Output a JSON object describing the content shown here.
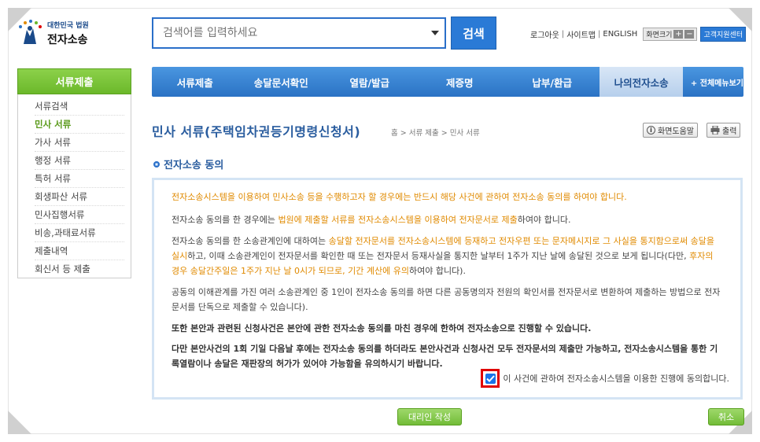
{
  "header": {
    "logo_small": "대한민국 법원",
    "logo_big": "전자소송",
    "search_placeholder": "검색어를 입력하세요",
    "search_button": "검색",
    "util_links": [
      "로그아웃",
      "사이트맵",
      "ENGLISH"
    ],
    "font_size_label": "화면크기",
    "font_plus": "+",
    "font_minus": "−",
    "customer_center": "고객지원센터"
  },
  "sidebar": {
    "title": "서류제출",
    "items": [
      {
        "label": "서류검색"
      },
      {
        "label": "민사 서류",
        "active": true
      },
      {
        "label": "가사 서류"
      },
      {
        "label": "행정 서류"
      },
      {
        "label": "특허 서류"
      },
      {
        "label": "회생파산 서류"
      },
      {
        "label": "민사집행서류"
      },
      {
        "label": "비송,과태료서류"
      },
      {
        "label": "제출내역"
      },
      {
        "label": "회신서 등 제출"
      }
    ]
  },
  "nav": {
    "items": [
      {
        "label": "서류제출"
      },
      {
        "label": "송달문서확인"
      },
      {
        "label": "열람/발급"
      },
      {
        "label": "제증명"
      },
      {
        "label": "납부/환급"
      },
      {
        "label": "나의전자소송",
        "active": true
      }
    ],
    "all_menu": "+ 전체메뉴보기"
  },
  "page": {
    "title": "민사 서류(주택임차권등기명령신청서)",
    "breadcrumb": "홈 > 서류 제출 > 민사 서류",
    "help_button": "화면도움말",
    "print_button": "출력"
  },
  "section": {
    "title": "전자소송 동의"
  },
  "content": {
    "p1": "전자소송시스템을 이용하여 민사소송 등을 수행하고자 할 경우에는 반드시 해당 사건에 관하여 전자소송 동의를 하여야 합니다.",
    "p2_a": "전자소송 동의를 한 경우에는 ",
    "p2_hl": "법원에 제출할 서류를 전자소송시스템을 이용하여 전자문서로 제출",
    "p2_b": "하여야 합니다.",
    "p3_a": "전자소송 동의를 한 소송관계인에 대하여는 ",
    "p3_hl1": "송달할 전자문서를 전자소송시스템에 등재하고 전자우편 또는 문자메시지로 그 사실을 통지함으로써 송달을 실시",
    "p3_b": "하고, 이때 소송관계인이 전자문서를 확인한 때 또는 전자문서 등재사실을 통지한 날부터 1주가 지난 날에 송달된 것으로 보게 됩니다(다만, ",
    "p3_hl2": "후자의 경우 송달간주일은 1주가 지난 날 0시가 되므로, 기간 계산에 유의",
    "p3_c": "하여야 합니다).",
    "p4": "공동의 이해관계를 가진 여러 소송관계인 중 1인이 전자소송 동의를 하면 다른 공동명의자 전원의 확인서를 전자문서로 변환하여 제출하는 방법으로 전자문서를 단독으로 제출할 수 있습니다).",
    "p5": "또한 본안과 관련된 신청사건은 본안에 관한 전자소송 동의를 마친 경우에 한하여 전자소송으로 진행할 수 있습니다.",
    "p6": "다만 본안사건의 1회 기일 다음날 후에는 전자소송 동의를 하더라도 본안사건과 신청사건 모두 전자문서의 제출만 가능하고, 전자소송시스템을 통한 기록열람이나 송달은 재판장의 허가가 있어야 가능함을 유의하시기 바랍니다.",
    "agree_label": "이 사건에 관하여 전자소송시스템을 이용한 진행에 동의합니다.",
    "agree_checked": true
  },
  "buttons": {
    "proxy": "대리인 작성",
    "cancel": "취소"
  },
  "colors": {
    "primary_blue": "#2a72c4",
    "green": "#6bb82a",
    "orange_text": "#e08a00",
    "highlight_red": "#e00000"
  }
}
